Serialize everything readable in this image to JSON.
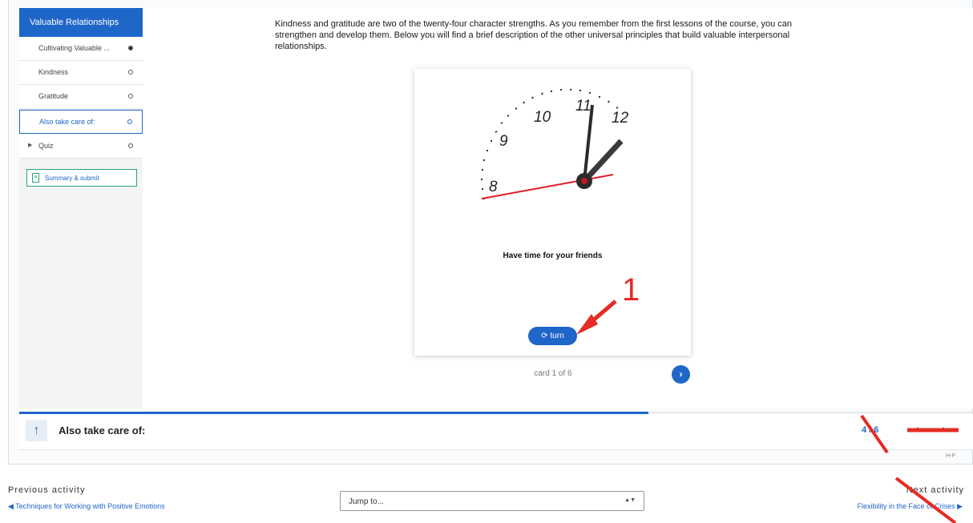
{
  "sidebar": {
    "header": "Valuable Relationships",
    "items": [
      {
        "label": "Cultivating Valuable ...",
        "status": "filled"
      },
      {
        "label": "Kindness",
        "status": "empty"
      },
      {
        "label": "Gratitude",
        "status": "empty"
      },
      {
        "label": "Also take care of:",
        "status": "empty",
        "active": true
      },
      {
        "label": "Quiz",
        "status": "empty",
        "collapsible": true
      }
    ],
    "summary_button": "Summary & submit"
  },
  "intro_text": "Kindness and gratitude are two of the twenty-four character strengths. As you remember from the first lessons of the course, you can strengthen and develop them. Below you will find a brief description of the other universal principles that build valuable interpersonal relationships.",
  "flashcard": {
    "caption": "Have time for your friends",
    "turn_label": "turn",
    "counter": "card 1 of 6",
    "next_icon": "chevron-right-icon",
    "clock_numbers": [
      "8",
      "9",
      "10",
      "11",
      "12"
    ]
  },
  "section_bar": {
    "title": "Also take care of:",
    "page": "4 / 6",
    "hp_tag": "H-P"
  },
  "activity_nav": {
    "previous_label": "Previous activity",
    "previous_link": "◀ Techniques for Working with Positive Emotions",
    "jump_placeholder": "Jump to...",
    "next_label": "Next activity",
    "next_link": "Flexibility in the Face of Crises ▶"
  },
  "annotation": {
    "marker": "1",
    "color": "#e52b23"
  },
  "colors": {
    "accent": "#1f66c9",
    "success": "#2aa37c"
  }
}
